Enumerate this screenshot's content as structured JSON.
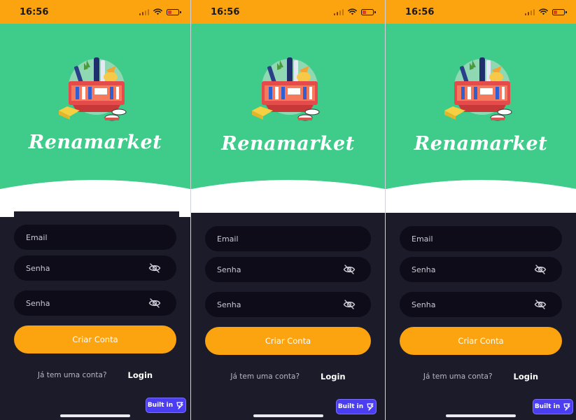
{
  "screens": [
    {
      "status": {
        "time": "16:56"
      },
      "brand": "Renamarket",
      "form": {
        "email_placeholder": "Email",
        "password_placeholder": "Senha",
        "confirm_placeholder": "Senha",
        "submit_label": "Criar Conta"
      },
      "footer": {
        "question": "Já tem uma conta?",
        "login_label": "Login"
      },
      "badge": "Built in"
    },
    {
      "status": {
        "time": "16:56"
      },
      "brand": "Renamarket",
      "form": {
        "email_placeholder": "Email",
        "password_placeholder": "Senha",
        "confirm_placeholder": "Senha",
        "submit_label": "Criar Conta"
      },
      "footer": {
        "question": "Já tem uma conta?",
        "login_label": "Login"
      },
      "badge": "Built in"
    },
    {
      "status": {
        "time": "16:56"
      },
      "brand": "Renamarket",
      "form": {
        "email_placeholder": "Email",
        "password_placeholder": "Senha",
        "confirm_placeholder": "Senha",
        "submit_label": "Criar Conta"
      },
      "footer": {
        "question": "Já tem uma conta?",
        "login_label": "Login"
      },
      "badge": "Built in"
    }
  ],
  "theme": {
    "status_bar": "#fca310",
    "hero": "#3fcb8a",
    "background": "#1c1b2a",
    "field": "#0d0c18",
    "accent": "#fca310",
    "badge": "#4b3df2"
  },
  "icons": {
    "status": [
      "signal-icon",
      "wifi-icon",
      "battery-icon"
    ],
    "field": "eye-off-icon",
    "illustration": "grocery-basket-icon",
    "badge": "builder-logo-icon"
  }
}
